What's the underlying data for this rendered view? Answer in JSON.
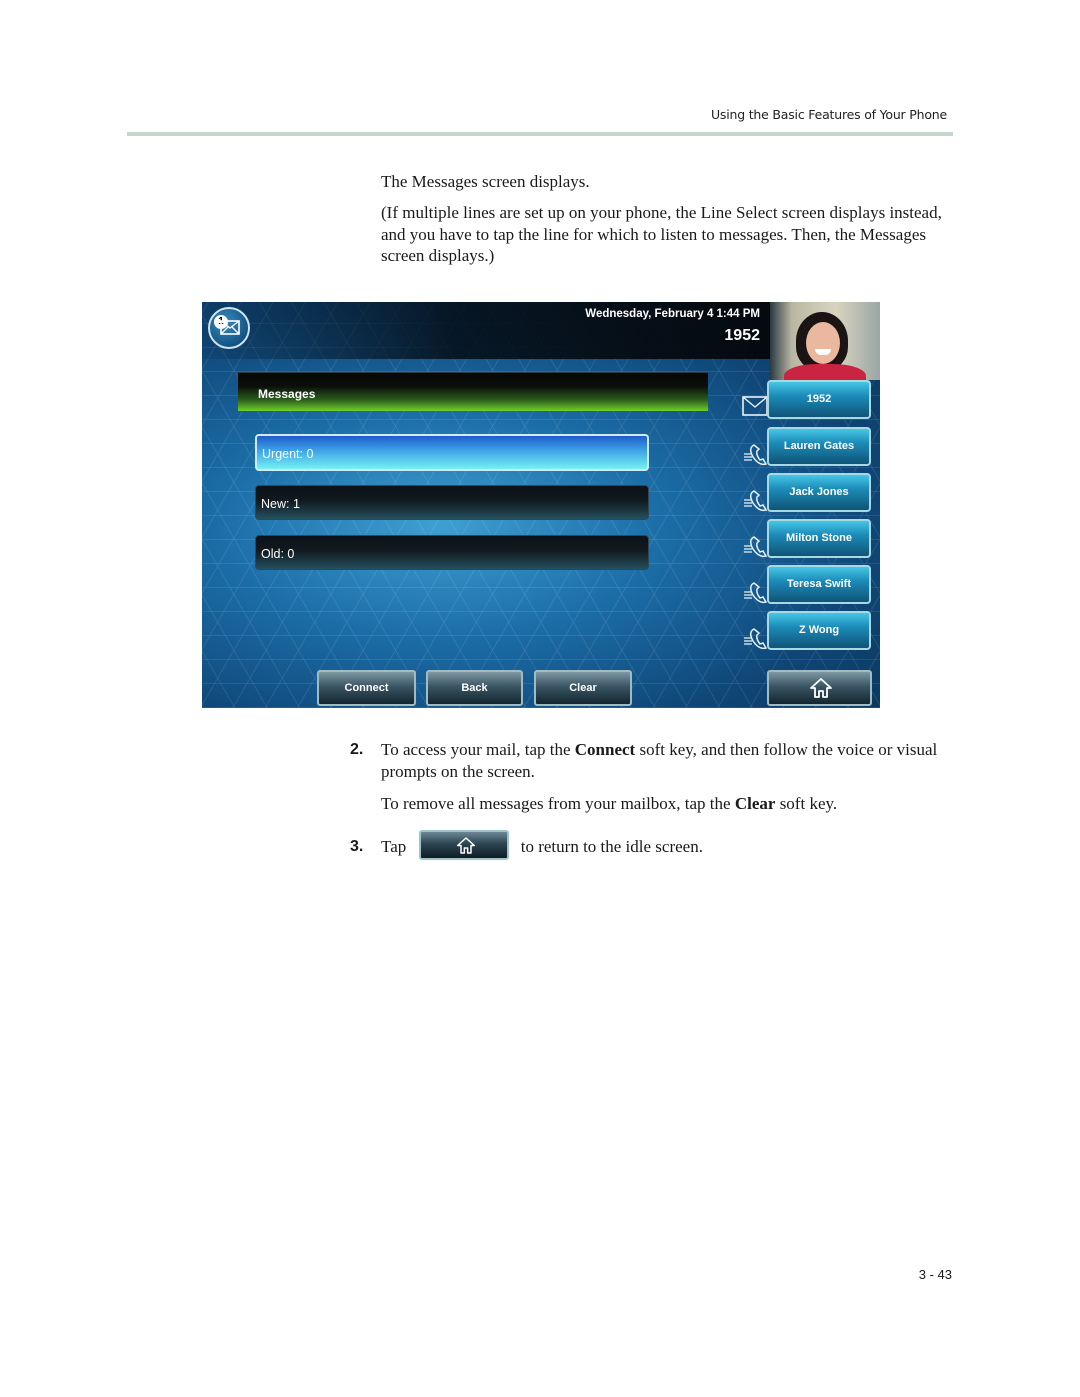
{
  "page": {
    "running_header": "Using the Basic Features of Your Phone",
    "page_number": "3 - 43",
    "intro": "The Messages screen displays.",
    "note": "(If multiple lines are set up on your phone, the Line Select screen displays instead, and you have to tap the line for which to listen to messages. Then, the Messages screen displays.)",
    "steps": [
      {
        "number": "2.",
        "text_before": "To access your mail, tap the ",
        "keyword": "Connect",
        "text_after": " soft key, and then follow the voice or visual prompts on the screen."
      },
      {
        "number": "3.",
        "text_before": "Tap",
        "icon": "home-icon",
        "text_after": "to return to the idle screen."
      }
    ],
    "step2_followup": {
      "text_before": "To remove all messages from your mailbox, tap the ",
      "keyword": "Clear",
      "text_after": " soft key."
    }
  },
  "phone": {
    "message_indicator_count": "1",
    "datetime": "Wednesday, February 4  1:44 PM",
    "extension": "1952",
    "screen_title": "Messages",
    "message_rows": [
      {
        "label": "Urgent: 0",
        "selected": true
      },
      {
        "label": "New: 1",
        "selected": false
      },
      {
        "label": "Old: 0",
        "selected": false
      }
    ],
    "line_keys": [
      {
        "label": "1952",
        "icon": "envelope-icon"
      },
      {
        "label": "Lauren Gates",
        "icon": "phone-handset-icon"
      },
      {
        "label": "Jack Jones",
        "icon": "phone-handset-icon"
      },
      {
        "label": "Milton Stone",
        "icon": "phone-handset-icon"
      },
      {
        "label": "Teresa Swift",
        "icon": "phone-handset-icon"
      },
      {
        "label": "Z Wong",
        "icon": "phone-handset-icon"
      }
    ],
    "softkeys": [
      "Connect",
      "Back",
      "Clear"
    ],
    "home_key_icon": "home-icon",
    "colors": {
      "header_accent": "#6fcf2a",
      "selected_row": "#3fa4e6",
      "line_key": "#1c8bb8"
    }
  }
}
